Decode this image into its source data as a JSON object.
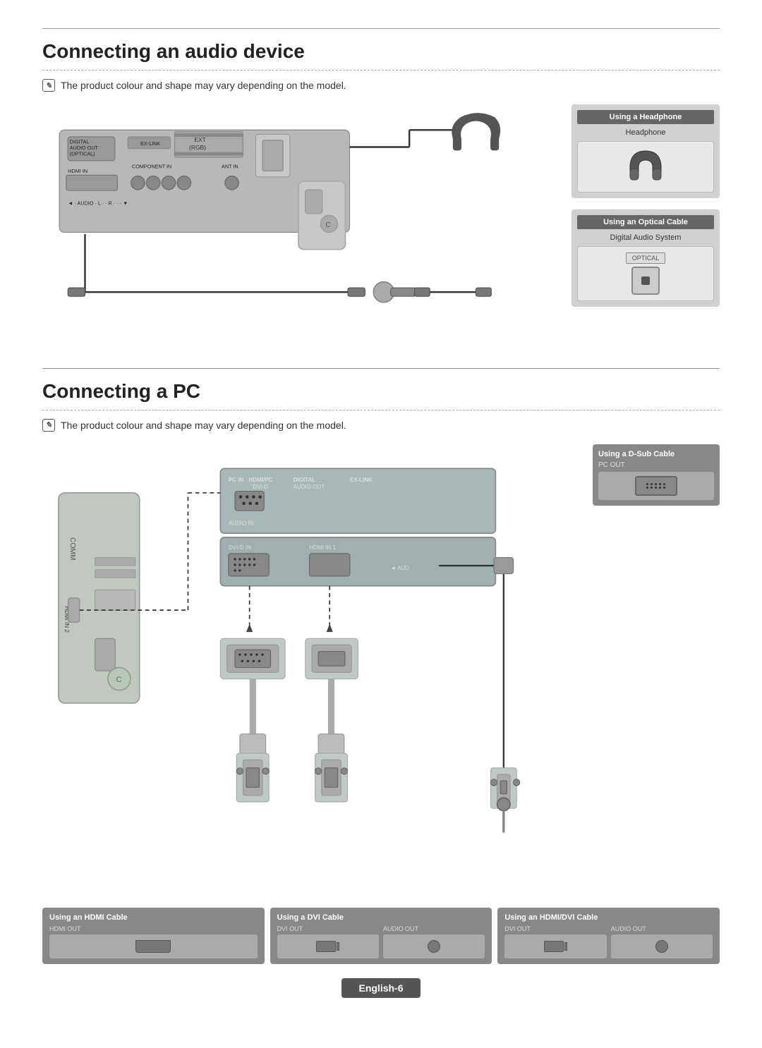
{
  "section1": {
    "title": "Connecting an audio device",
    "note": "The product colour and shape may vary depending on the model.",
    "headphone_panel": {
      "header": "Using a Headphone",
      "label": "Headphone"
    },
    "optical_panel": {
      "header": "Using an Optical Cable",
      "label": "Digital Audio System",
      "port_label": "OPTICAL"
    }
  },
  "section2": {
    "title": "Connecting a PC",
    "note": "The product colour and shape may vary depending on the model.",
    "dsub_panel": {
      "header": "Using a D-Sub Cable",
      "label": "PC OUT"
    },
    "bottom_panels": [
      {
        "title": "Using an HDMI Cable",
        "ports": [
          {
            "label": "HDMI OUT",
            "type": "hdmi"
          }
        ]
      },
      {
        "title": "Using a DVI Cable",
        "ports": [
          {
            "label": "DVI OUT",
            "type": "dvi"
          },
          {
            "label": "AUDIO OUT",
            "type": "audio"
          }
        ]
      },
      {
        "title": "Using an HDMI/DVI Cable",
        "ports": [
          {
            "label": "DVI OUT",
            "type": "dvi"
          },
          {
            "label": "AUDIO OUT",
            "type": "audio"
          }
        ]
      }
    ]
  },
  "footer": {
    "badge": "English-6"
  },
  "icons": {
    "note_icon": "✎",
    "headphone": "🎧"
  }
}
